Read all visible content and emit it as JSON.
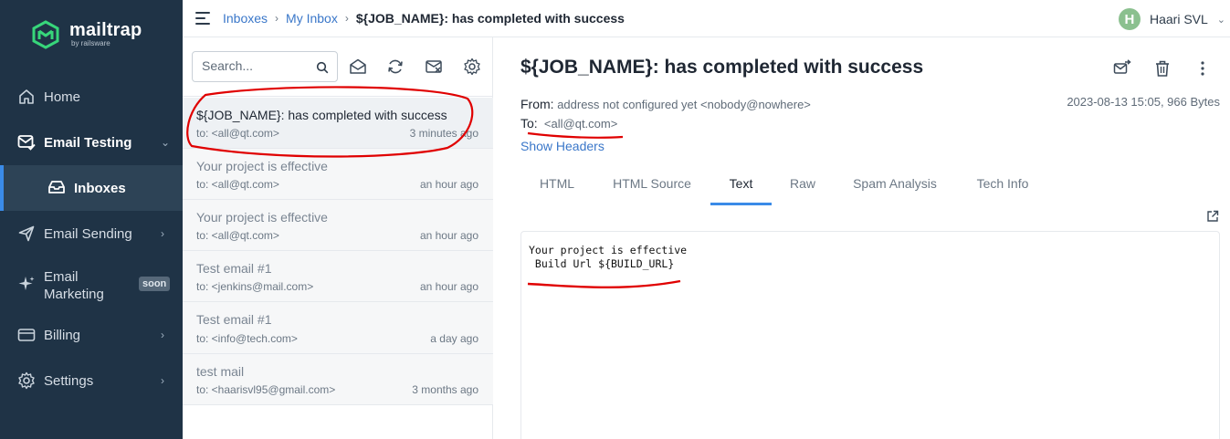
{
  "brand": {
    "name": "mailtrap",
    "sub": "by railsware",
    "accent": "#37d67a"
  },
  "sidebar": {
    "items": [
      {
        "label": "Home",
        "icon": "home-icon"
      },
      {
        "label": "Email Testing",
        "icon": "email-testing-icon"
      },
      {
        "label": "Inboxes",
        "icon": "inbox-icon"
      },
      {
        "label": "Email Sending",
        "icon": "send-icon"
      },
      {
        "label": "Email Marketing",
        "icon": "sparkle-icon",
        "badge": "soon"
      },
      {
        "label": "Billing",
        "icon": "card-icon"
      },
      {
        "label": "Settings",
        "icon": "gear-icon"
      }
    ],
    "marketing_line1": "Email",
    "marketing_line2": "Marketing"
  },
  "topbar": {
    "crumbs": [
      "Inboxes",
      "My Inbox"
    ],
    "current": "${JOB_NAME}: has completed with success",
    "user_initial": "H",
    "user_name": "Haari SVL"
  },
  "list": {
    "search_placeholder": "Search...",
    "messages": [
      {
        "subject": "${JOB_NAME}: has completed with success",
        "to": "to: <all@qt.com>",
        "time": "3 minutes ago"
      },
      {
        "subject": "Your project is effective",
        "to": "to: <all@qt.com>",
        "time": "an hour ago"
      },
      {
        "subject": "Your project is effective",
        "to": "to: <all@qt.com>",
        "time": "an hour ago"
      },
      {
        "subject": "Test email #1",
        "to": "to: <jenkins@mail.com>",
        "time": "an hour ago"
      },
      {
        "subject": "Test email #1",
        "to": "to: <info@tech.com>",
        "time": "a day ago"
      },
      {
        "subject": "test mail",
        "to": "to: <haarisvl95@gmail.com>",
        "time": "3 months ago"
      }
    ]
  },
  "detail": {
    "title": "${JOB_NAME}: has completed with success",
    "from_label": "From:",
    "from_value": "address not configured yet <nobody@nowhere>",
    "to_label": "To:",
    "to_value": "<all@qt.com>",
    "date_size": "2023-08-13 15:05, 966 Bytes",
    "show_headers": "Show Headers",
    "tabs": [
      "HTML",
      "HTML Source",
      "Text",
      "Raw",
      "Spam Analysis",
      "Tech Info"
    ],
    "active_tab": "Text",
    "body_line1": "Your project is effective",
    "body_line2": " Build Url ${BUILD_URL}"
  },
  "annotation_color": "#e00000"
}
